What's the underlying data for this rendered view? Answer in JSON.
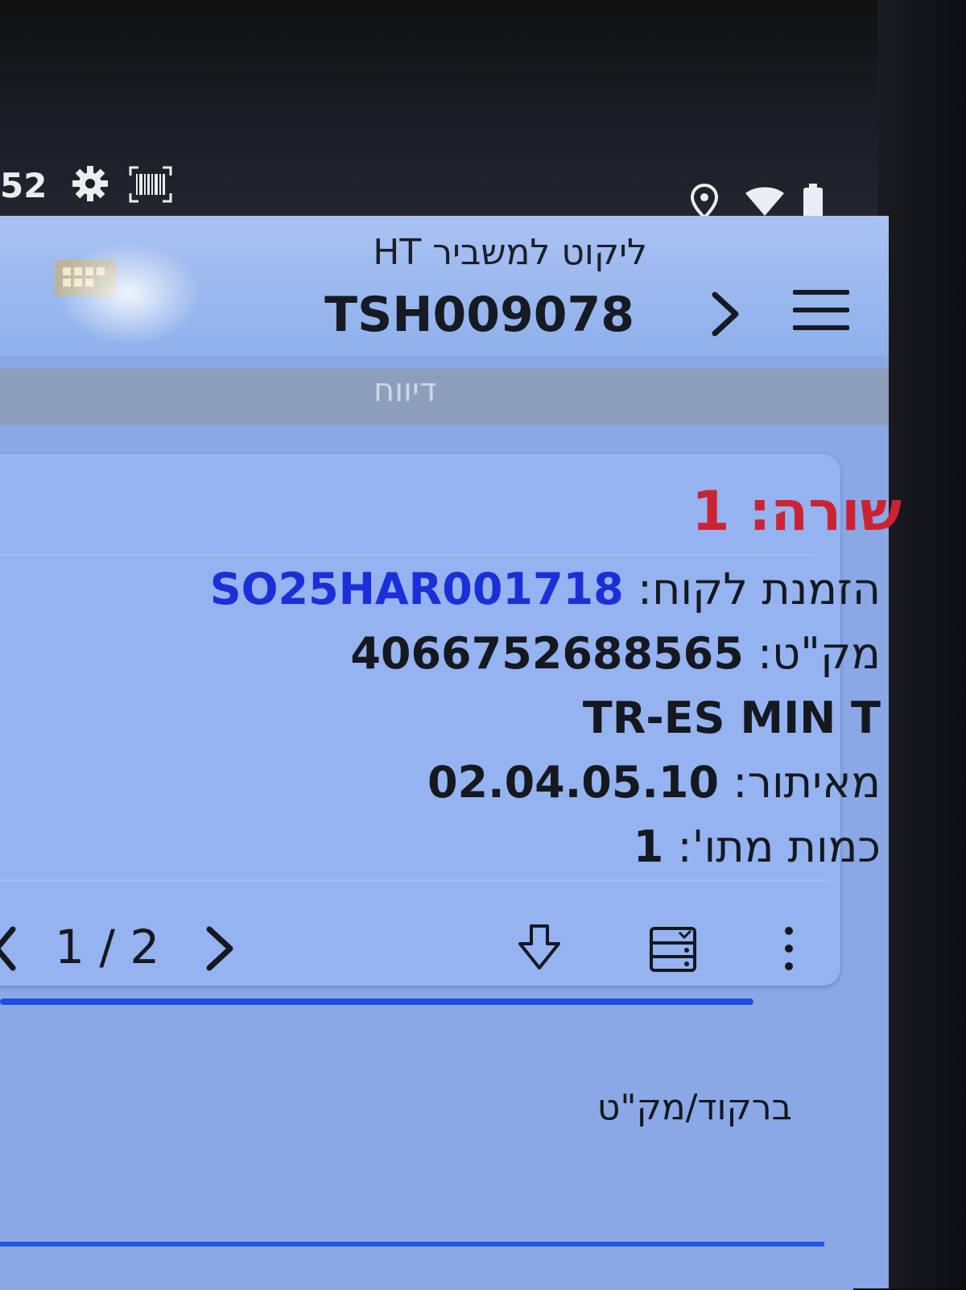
{
  "status_bar": {
    "time": "52",
    "icons": [
      "gear-icon",
      "barcode-icon",
      "location-icon",
      "wifi-icon",
      "battery-icon"
    ]
  },
  "app_bar": {
    "subtitle": "ליקוט למשביר HT",
    "title": "TSH009078",
    "icons": [
      "menu-icon",
      "chevron-right-icon",
      "scanner-logo-icon"
    ]
  },
  "report_tab": {
    "label": "דיווח"
  },
  "record": {
    "row_label": "שורה: 1",
    "order_label": "הזמנת לקוח:",
    "order_value": "SO25HAR001718",
    "sku_label": "מק\"ט:",
    "sku_value": "4066752688565",
    "description": "TR-ES MIN T",
    "location_label": "מאיתור:",
    "location_value": "02.04.05.10",
    "quantity_label": "כמות מתו':",
    "quantity_value": "1"
  },
  "pager": {
    "text": "1 / 2"
  },
  "actions": [
    "download-icon",
    "storage-icon",
    "more-vertical-icon"
  ],
  "barcode_field": {
    "label": "ברקוד/מק\"ט",
    "value": ""
  },
  "colors": {
    "screen_bg": "#8aa8e6",
    "row_label": "#cc2333",
    "order_value": "#1b2fd8",
    "accent_line": "#1f4fe0"
  }
}
